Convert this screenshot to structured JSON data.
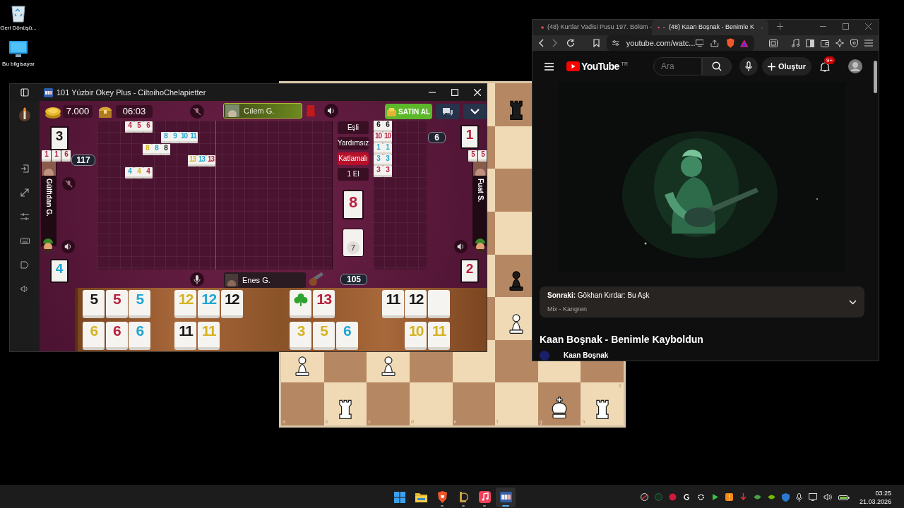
{
  "desktop_icons": [
    {
      "kind": "recycle",
      "label": "Geri Dönüşü..."
    },
    {
      "kind": "computer",
      "label": "Bu bilgisayar"
    }
  ],
  "chess": {
    "files": [
      "a",
      "b",
      "c",
      "d",
      "e",
      "f",
      "g",
      "h"
    ],
    "rank_label": "1",
    "ranks": [
      [
        {
          "kind": "empty"
        },
        {
          "kind": "empty"
        },
        {
          "kind": "empty"
        },
        {
          "kind": "empty"
        },
        {
          "kind": "empty"
        },
        {
          "kind": "black_rook"
        },
        {
          "kind": "empty"
        },
        {
          "kind": "empty"
        }
      ],
      [
        {
          "kind": "empty"
        },
        {
          "kind": "empty"
        },
        {
          "kind": "empty"
        },
        {
          "kind": "empty"
        },
        {
          "kind": "empty"
        },
        {
          "kind": "empty"
        },
        {
          "kind": "empty"
        },
        {
          "kind": "empty"
        }
      ],
      [
        {
          "kind": "empty"
        },
        {
          "kind": "empty"
        },
        {
          "kind": "empty"
        },
        {
          "kind": "empty"
        },
        {
          "kind": "empty"
        },
        {
          "kind": "empty"
        },
        {
          "kind": "empty"
        },
        {
          "kind": "empty"
        }
      ],
      [
        {
          "kind": "empty"
        },
        {
          "kind": "empty"
        },
        {
          "kind": "empty"
        },
        {
          "kind": "empty"
        },
        {
          "kind": "empty"
        },
        {
          "kind": "empty"
        },
        {
          "kind": "empty"
        },
        {
          "kind": "empty"
        }
      ],
      [
        {
          "kind": "empty"
        },
        {
          "kind": "empty"
        },
        {
          "kind": "empty"
        },
        {
          "kind": "empty"
        },
        {
          "kind": "empty"
        },
        {
          "kind": "black_pawn"
        },
        {
          "kind": "empty"
        },
        {
          "kind": "empty"
        }
      ],
      [
        {
          "kind": "empty"
        },
        {
          "kind": "empty"
        },
        {
          "kind": "empty"
        },
        {
          "kind": "empty"
        },
        {
          "kind": "empty"
        },
        {
          "kind": "white_pawn"
        },
        {
          "kind": "empty"
        },
        {
          "kind": "empty"
        }
      ],
      [
        {
          "kind": "white_pawn"
        },
        {
          "kind": "empty"
        },
        {
          "kind": "white_pawn"
        },
        {
          "kind": "empty"
        },
        {
          "kind": "empty"
        },
        {
          "kind": "empty"
        },
        {
          "kind": "empty"
        },
        {
          "kind": "empty"
        }
      ],
      [
        {
          "kind": "empty"
        },
        {
          "kind": "white_rook"
        },
        {
          "kind": "empty"
        },
        {
          "kind": "empty"
        },
        {
          "kind": "empty"
        },
        {
          "kind": "empty"
        },
        {
          "kind": "white_king"
        },
        {
          "kind": "white_rook"
        }
      ]
    ]
  },
  "okey_window": {
    "title": "101 Yüzbir Okey Plus - CiltoihoChelapietter",
    "coins": "7.000",
    "timer": "06:03",
    "top_player": "Cılem G.",
    "left_player": {
      "name": "Gülfidan G.",
      "score": "117",
      "tiles": [
        {
          "number": "1",
          "color": "#b8213f"
        },
        {
          "number": "1",
          "color": "#b8213f"
        },
        {
          "number": "6",
          "color": "#b8213f"
        }
      ]
    },
    "right_player": {
      "name": "Fuat S.",
      "score": "6",
      "tiles": [
        {
          "number": "5",
          "color": "#b8213f"
        },
        {
          "number": "5",
          "color": "#b8213f"
        }
      ]
    },
    "bottom_player": {
      "name": "Enes G.",
      "score": "105"
    },
    "corner_tiles": [
      {
        "number": "3",
        "color": "#1a1a1a"
      },
      {
        "number": "1",
        "color": "#b8213f"
      },
      {
        "number": "4",
        "color": "#22a6d2"
      },
      {
        "number": "2",
        "color": "#b8213f"
      }
    ],
    "buy_button": "SATIN AL",
    "rules": [
      {
        "label": "Eşli",
        "selected": false
      },
      {
        "label": "Yardımsız",
        "selected": false
      },
      {
        "label": "Katlamalı",
        "selected": true
      },
      {
        "label": "1 El",
        "selected": false
      }
    ],
    "indicator_tile": {
      "number": "8",
      "color": "#b8213f"
    },
    "deck_count": "7",
    "table_melds": [
      [
        {
          "number": "4",
          "color": "#b8213f"
        },
        {
          "number": "5",
          "color": "#b8213f"
        },
        {
          "number": "6",
          "color": "#b8213f"
        }
      ],
      [
        {
          "number": "8",
          "color": "#22a6d2"
        },
        {
          "number": "9",
          "color": "#22a6d2"
        },
        {
          "number": "10",
          "color": "#22a6d2"
        },
        {
          "number": "11",
          "color": "#22a6d2"
        }
      ],
      [
        {
          "number": "8",
          "color": "#d6b322"
        },
        {
          "number": "8",
          "color": "#22a6d2"
        },
        {
          "number": "8",
          "color": "#1a1a1a"
        }
      ],
      [
        {
          "number": "13",
          "color": "#d6b322"
        },
        {
          "number": "13",
          "color": "#22a6d2"
        },
        {
          "number": "13",
          "color": "#b8213f"
        }
      ],
      [
        {
          "number": "4",
          "color": "#22a6d2"
        },
        {
          "number": "4",
          "color": "#d6b322"
        },
        {
          "number": "4",
          "color": "#b8213f"
        }
      ]
    ],
    "side_melds": [
      [
        {
          "number": "6",
          "color": "#1a1a1a"
        },
        {
          "number": "6",
          "color": "#1a1a1a"
        }
      ],
      [
        {
          "number": "10",
          "color": "#b8213f"
        },
        {
          "number": "10",
          "color": "#b8213f"
        }
      ],
      [
        {
          "number": "1",
          "color": "#22a6d2"
        },
        {
          "number": "1",
          "color": "#22a6d2"
        }
      ],
      [
        {
          "number": "3",
          "color": "#22a6d2"
        },
        {
          "number": "3",
          "color": "#22a6d2"
        }
      ],
      [
        {
          "number": "3",
          "color": "#b8213f"
        },
        {
          "number": "3",
          "color": "#b8213f"
        }
      ]
    ],
    "rack": [
      [
        {
          "kind": "number",
          "number": "5",
          "color": "#1a1a1a"
        },
        {
          "kind": "number",
          "number": "5",
          "color": "#b8213f"
        },
        {
          "kind": "number",
          "number": "5",
          "color": "#22a6d2"
        },
        {
          "kind": "empty"
        },
        {
          "kind": "number",
          "number": "12",
          "color": "#d6b322"
        },
        {
          "kind": "number",
          "number": "12",
          "color": "#22a6d2"
        },
        {
          "kind": "number",
          "number": "12",
          "color": "#1a1a1a"
        },
        {
          "kind": "empty"
        },
        {
          "kind": "empty"
        },
        {
          "kind": "joker",
          "color": "#2fa32f"
        },
        {
          "kind": "number",
          "number": "13",
          "color": "#b8213f"
        },
        {
          "kind": "empty"
        },
        {
          "kind": "empty"
        },
        {
          "kind": "number",
          "number": "11",
          "color": "#1a1a1a"
        },
        {
          "kind": "number",
          "number": "12",
          "color": "#1a1a1a"
        },
        {
          "kind": "blank"
        }
      ],
      [
        {
          "kind": "number",
          "number": "6",
          "color": "#d6b322"
        },
        {
          "kind": "number",
          "number": "6",
          "color": "#b8213f"
        },
        {
          "kind": "number",
          "number": "6",
          "color": "#22a6d2"
        },
        {
          "kind": "empty"
        },
        {
          "kind": "number",
          "number": "11",
          "color": "#1a1a1a"
        },
        {
          "kind": "number",
          "number": "11",
          "color": "#d6b322"
        },
        {
          "kind": "empty"
        },
        {
          "kind": "empty"
        },
        {
          "kind": "empty"
        },
        {
          "kind": "number",
          "number": "3",
          "color": "#d6b322"
        },
        {
          "kind": "number",
          "number": "5",
          "color": "#d6b322"
        },
        {
          "kind": "number",
          "number": "6",
          "color": "#22a6d2"
        },
        {
          "kind": "empty"
        },
        {
          "kind": "empty"
        },
        {
          "kind": "number",
          "number": "10",
          "color": "#d6b322"
        },
        {
          "kind": "number",
          "number": "11",
          "color": "#d6b322"
        }
      ]
    ]
  },
  "browser": {
    "tabs": [
      {
        "title": "(48) Kurtlar Vadisi Pusu 197. Bölüm -",
        "selected": false,
        "audio": false
      },
      {
        "title": "(48) Kaan Boşnak - Benimle K",
        "selected": true,
        "audio": true
      }
    ],
    "url": "youtube.com/watc...",
    "logo": "YouTube",
    "region": "TR",
    "search_placeholder": "Ara",
    "create_button": "Oluştur",
    "notification_badge": "9+",
    "up_next": {
      "title": "**Sonraki:** Gökhan Kırdar: Bu Aşk",
      "subtitle": "Mix - Kangren"
    },
    "video_title": "Kaan Boşnak - Benimle Kayboldun",
    "channel": "Kaan Boşnak"
  },
  "taskbar": {
    "apps": [
      {
        "kind": "start",
        "running": false,
        "active": false
      },
      {
        "kind": "files",
        "running": false,
        "active": false
      },
      {
        "kind": "brave",
        "running": true,
        "active": false
      },
      {
        "kind": "league",
        "running": true,
        "active": false
      },
      {
        "kind": "music",
        "running": true,
        "active": false
      },
      {
        "kind": "okey",
        "running": true,
        "active": true
      }
    ],
    "time": "03:25",
    "date": "21.03.2026"
  }
}
